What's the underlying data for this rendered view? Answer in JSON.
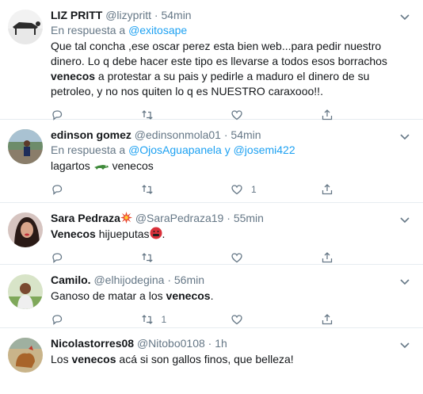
{
  "tweets": [
    {
      "name": "LIZ PRITT",
      "handle": "@lizypritt",
      "time": "54min",
      "reply_prefix": "En respuesta a",
      "reply_to": "@exitosape",
      "text_plain": "Que tal concha ,ese oscar perez esta bien web...para pedir nuestro dinero. Lo q debe hacer este tipo es llevarse a todos  esos borrachos ",
      "text_bold": "venecos",
      "text_after": " a protestar a su pais  y pedirle a maduro el dinero de su petroleo, y no nos quiten lo q es NUESTRO caraxooo!!.",
      "likes": ""
    },
    {
      "name": "edinson gomez",
      "handle": "@edinsonmola01",
      "time": "54min",
      "reply_prefix": "En respuesta a",
      "reply_to": "@OjosAguapanela",
      "reply_and": "y",
      "reply_to2": "@josemi422",
      "text_before": "lagartos",
      "text_after": "venecos",
      "likes": "1"
    },
    {
      "name": "Sara Pedraza",
      "handle": "@SaraPedraza19",
      "time": "55min",
      "text_bold": "Venecos",
      "text_after": " hijueputas",
      "text_end": ".",
      "likes": ""
    },
    {
      "name": "Camilo.",
      "handle": "@elhijodegina",
      "time": "56min",
      "text_before": "Ganoso de matar a los ",
      "text_bold": "venecos",
      "text_after": ".",
      "retweets": "1",
      "likes": ""
    },
    {
      "name": "Nicolastorres08",
      "handle": "@Nitobo0108",
      "time": "1h",
      "text_before": "Los ",
      "text_bold": "venecos",
      "text_after": " acá si son gallos finos, que belleza!"
    }
  ],
  "dot": "·",
  "icons": [
    "reply-icon",
    "retweet-icon",
    "like-icon",
    "share-icon",
    "caret-down-icon"
  ],
  "colors": {
    "link": "#1da1f2",
    "muted": "#657786",
    "border": "#e6ecf0"
  }
}
